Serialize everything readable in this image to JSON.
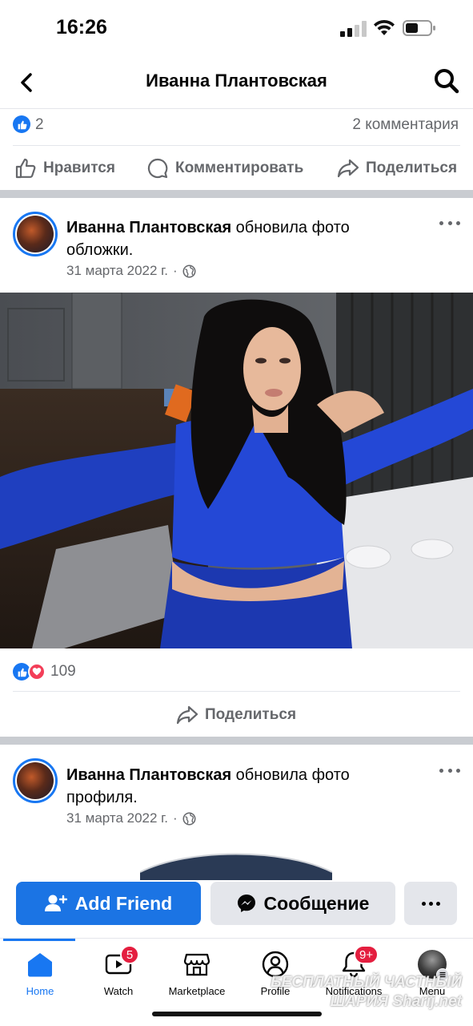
{
  "status_bar": {
    "time": "16:26"
  },
  "header": {
    "title": "Иванна Плантовская"
  },
  "previous_post": {
    "like_count": "2",
    "comments": "2 комментария",
    "actions": {
      "like": "Нравится",
      "comment": "Комментировать",
      "share": "Поделиться"
    }
  },
  "post1": {
    "author": "Иванна Плантовская",
    "action_text": " обновила фото обложки.",
    "date": "31 марта 2022 г.",
    "separator": "·",
    "reaction_count": "109",
    "share_label": "Поделиться"
  },
  "post2": {
    "author": "Иванна Плантовская",
    "action_text": " обновила фото профиля.",
    "date": "31 марта 2022 г.",
    "separator": "·"
  },
  "profile_actions": {
    "add_friend": "Add Friend",
    "message": "Сообщение"
  },
  "tab_bar": {
    "tabs": [
      {
        "label": "Home",
        "active": true
      },
      {
        "label": "Watch",
        "badge": "5"
      },
      {
        "label": "Marketplace"
      },
      {
        "label": "Profile"
      },
      {
        "label": "Notifications",
        "badge": "9+"
      },
      {
        "label": "Menu"
      }
    ]
  },
  "watermark": {
    "line1": "БЕСПЛАТНЫЙ ЧАСТНЫЙ",
    "line2": "ШАРИЯ",
    "line3": "Sharij.net"
  },
  "colors": {
    "accent": "#1877f2",
    "badge": "#e41e3f",
    "heart": "#f33e58",
    "muted": "#65676b"
  }
}
